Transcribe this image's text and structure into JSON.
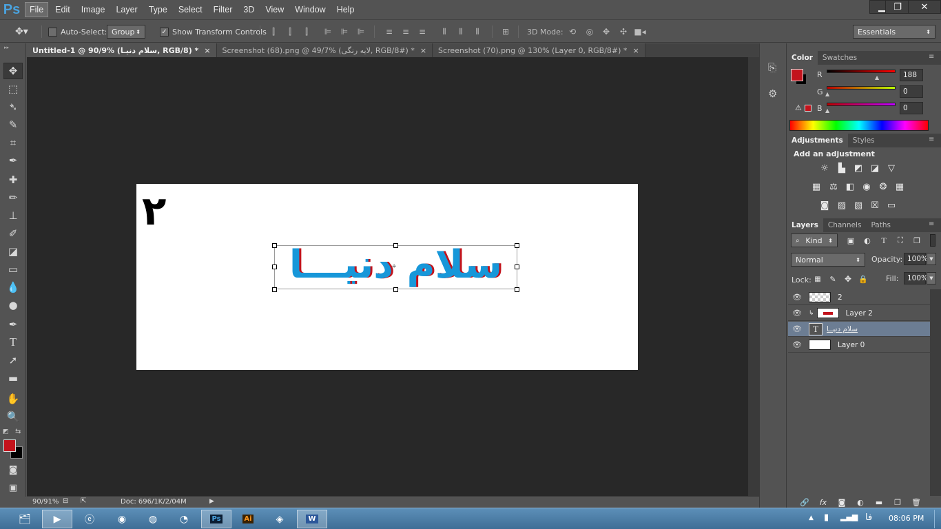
{
  "app": {
    "logo": "Ps"
  },
  "menu": [
    "File",
    "Edit",
    "Image",
    "Layer",
    "Type",
    "Select",
    "Filter",
    "3D",
    "View",
    "Window",
    "Help"
  ],
  "window_controls": {
    "minimize": "▁",
    "restore": "❐",
    "close": "✕"
  },
  "options": {
    "auto_select_label": "Auto-Select:",
    "auto_select_value": "Group",
    "show_transform_label": "Show Transform Controls",
    "mode_label": "3D Mode:",
    "workspace": "Essentials"
  },
  "tabs": [
    {
      "label": "Untitled-1 @ 90/9% (سلام دنیـا, RGB/8) *",
      "close": "×"
    },
    {
      "label": "Screenshot (68).png @ 49/7% (لایه رنگی, RGB/8#) *",
      "close": "×"
    },
    {
      "label": "Screenshot (70).png @ 130% (Layer 0, RGB/8#) *",
      "close": "×"
    }
  ],
  "document": {
    "number_text": "۲",
    "main_text": "سلام دنیـــا",
    "text_colors": {
      "red": "#c3131c",
      "blue": "#1797d9"
    }
  },
  "status": {
    "zoom": "90/91%",
    "doc": "Doc: 696/1K/2/04M"
  },
  "colors": {
    "foreground": "#c3131c",
    "background": "#000000",
    "accent_blue": "#4aa3df"
  },
  "color_panel": {
    "tabs": [
      "Color",
      "Swatches"
    ],
    "r_label": "R",
    "r_value": "188",
    "g_label": "G",
    "g_value": "0",
    "b_label": "B",
    "b_value": "0"
  },
  "adjustments_panel": {
    "tabs": [
      "Adjustments",
      "Styles"
    ],
    "heading": "Add an adjustment"
  },
  "layers_panel": {
    "tabs": [
      "Layers",
      "Channels",
      "Paths"
    ],
    "kind": "Kind",
    "blend_mode": "Normal",
    "opacity_label": "Opacity:",
    "opacity_value": "100%",
    "lock_label": "Lock:",
    "fill_label": "Fill:",
    "fill_value": "100%",
    "layers": [
      {
        "name": "2"
      },
      {
        "name": "Layer 2"
      },
      {
        "name": "سلام دنیــا"
      },
      {
        "name": "Layer 0"
      }
    ]
  },
  "taskbar": {
    "tray_lang": "فا",
    "time": "08:06 PM",
    "apps": [
      "explorer-icon",
      "media-player-icon",
      "ie-icon",
      "chrome-icon",
      "firefox-icon",
      "blender-icon",
      "photoshop-icon",
      "illustrator-icon",
      "norton-icon",
      "word-icon"
    ]
  }
}
